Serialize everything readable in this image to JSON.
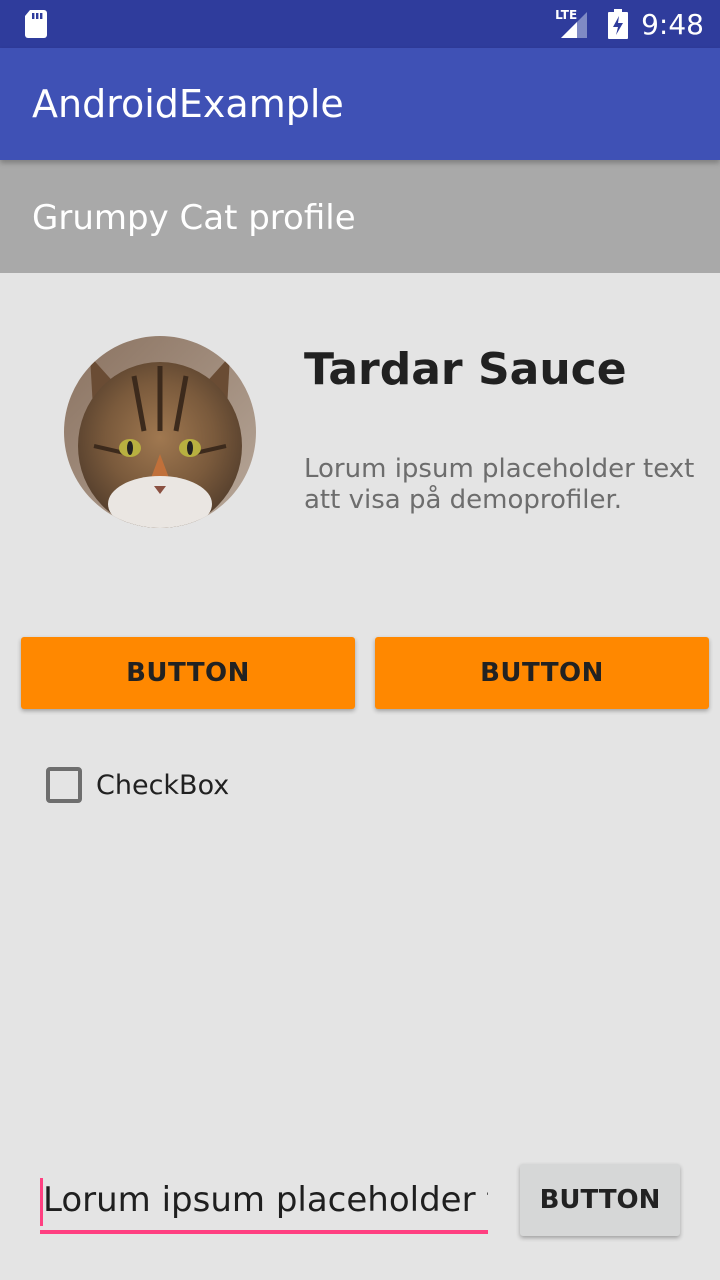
{
  "status_bar": {
    "time": "9:48",
    "network_label": "LTE",
    "icons": [
      "sd-card-icon",
      "lte-signal-icon",
      "battery-charging-icon"
    ]
  },
  "app_bar": {
    "title": "AndroidExample",
    "color": "#3f51b5"
  },
  "section_header": {
    "title": "Grumpy Cat profile"
  },
  "profile": {
    "name": "Tardar Sauce",
    "description": "Lorum ipsum placeholder text att visa på demoprofiler."
  },
  "buttons": {
    "left_label": "BUTTON",
    "right_label": "BUTTON",
    "bottom_label": "BUTTON",
    "accent_color": "#ff8800"
  },
  "checkbox": {
    "label": "CheckBox",
    "checked": false
  },
  "text_input": {
    "value": "Lorum ipsum placeholder te",
    "accent_color": "#ff4081"
  }
}
